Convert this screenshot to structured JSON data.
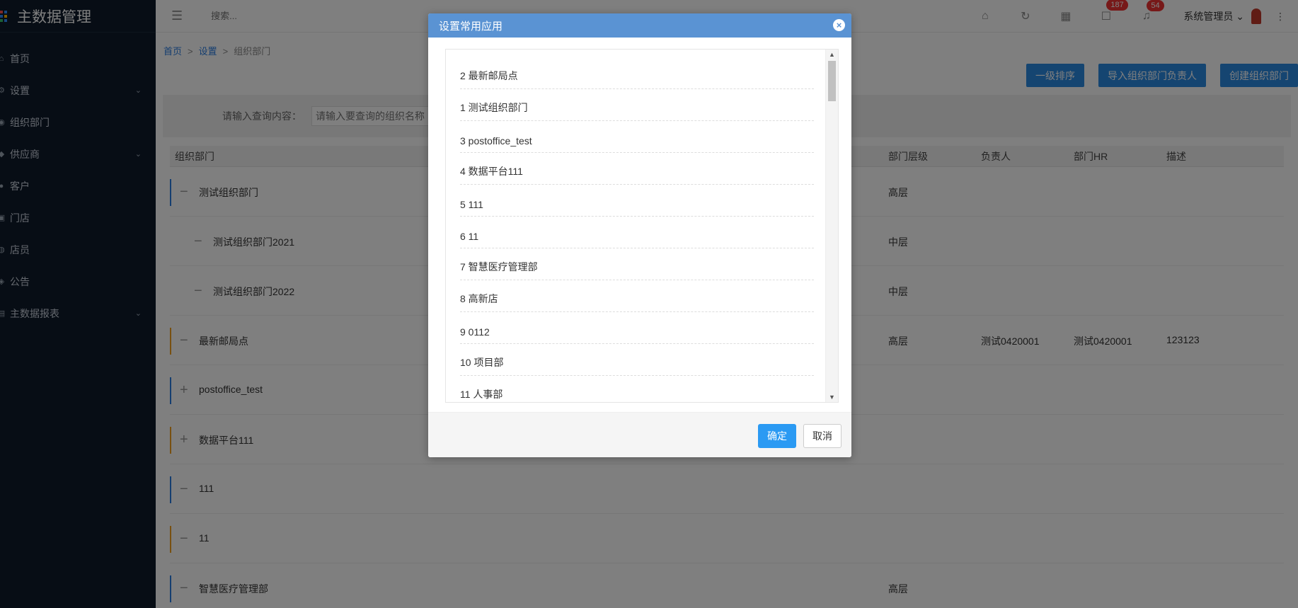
{
  "app": {
    "title": "主数据管理"
  },
  "sidebar": {
    "items": [
      {
        "label": "首页",
        "icon": "home-icon",
        "expandable": false
      },
      {
        "label": "设置",
        "icon": "settings-icon",
        "expandable": true
      },
      {
        "label": "组织部门",
        "icon": "org-icon",
        "expandable": false
      },
      {
        "label": "供应商",
        "icon": "supplier-icon",
        "expandable": true
      },
      {
        "label": "客户",
        "icon": "customer-icon",
        "expandable": false
      },
      {
        "label": "门店",
        "icon": "store-icon",
        "expandable": false
      },
      {
        "label": "店员",
        "icon": "clerk-icon",
        "expandable": false
      },
      {
        "label": "公告",
        "icon": "notice-icon",
        "expandable": false
      },
      {
        "label": "主数据报表",
        "icon": "report-icon",
        "expandable": true
      }
    ]
  },
  "topbar": {
    "search_placeholder": "搜索...",
    "badges": {
      "messages": "187",
      "notifications": "54"
    },
    "user": "系统管理员"
  },
  "breadcrumb": {
    "home": "首页",
    "settings": "设置",
    "current": "组织部门",
    "sep": ">"
  },
  "actions": {
    "sort": "一级排序",
    "import": "导入组织部门负责人",
    "create": "创建组织部门"
  },
  "query": {
    "label": "请输入查询内容：",
    "placeholder": "请输入要查询的组织名称"
  },
  "table": {
    "headers": {
      "dept": "组织部门",
      "level": "部门层级",
      "owner": "负责人",
      "hr": "部门HR",
      "desc": "描述"
    },
    "rows": [
      {
        "name": "测试组织部门",
        "toggle": "−",
        "indent": 0,
        "level": "高层",
        "owner": "",
        "hr": "",
        "desc": "",
        "bar": "#2b7de0"
      },
      {
        "name": "测试组织部门2021",
        "toggle": "−",
        "indent": 1,
        "level": "中层",
        "owner": "",
        "hr": "",
        "desc": "",
        "bar": ""
      },
      {
        "name": "测试组织部门2022",
        "toggle": "−",
        "indent": 1,
        "level": "中层",
        "owner": "",
        "hr": "",
        "desc": "",
        "bar": ""
      },
      {
        "name": "最新邮局点",
        "toggle": "−",
        "indent": 0,
        "level": "高层",
        "owner": "测试0420001",
        "hr": "测试0420001",
        "desc": "123123",
        "bar": "#f0a020"
      },
      {
        "name": "postoffice_test",
        "toggle": "+",
        "indent": 0,
        "level": "",
        "owner": "",
        "hr": "",
        "desc": "",
        "bar": "#2b7de0"
      },
      {
        "name": "数据平台111",
        "toggle": "+",
        "indent": 0,
        "level": "",
        "owner": "",
        "hr": "",
        "desc": "",
        "bar": "#f0a020"
      },
      {
        "name": "111",
        "toggle": "−",
        "indent": 0,
        "level": "",
        "owner": "",
        "hr": "",
        "desc": "",
        "bar": "#2b7de0"
      },
      {
        "name": "11",
        "toggle": "−",
        "indent": 0,
        "level": "",
        "owner": "",
        "hr": "",
        "desc": "",
        "bar": "#f0a020"
      },
      {
        "name": "智慧医疗管理部",
        "toggle": "−",
        "indent": 0,
        "level": "高层",
        "owner": "",
        "hr": "",
        "desc": "",
        "bar": "#2b7de0"
      }
    ]
  },
  "modal": {
    "title": "设置常用应用",
    "close": "×",
    "items": [
      "2 最新邮局点",
      "1 测试组织部门",
      "3 postoffice_test",
      "4 数据平台111",
      "5 111",
      "6 11",
      "7 智慧医疗管理部",
      "8 高新店",
      "9 0112",
      "10 项目部",
      "11 人事部"
    ],
    "ok": "确定",
    "cancel": "取消"
  }
}
